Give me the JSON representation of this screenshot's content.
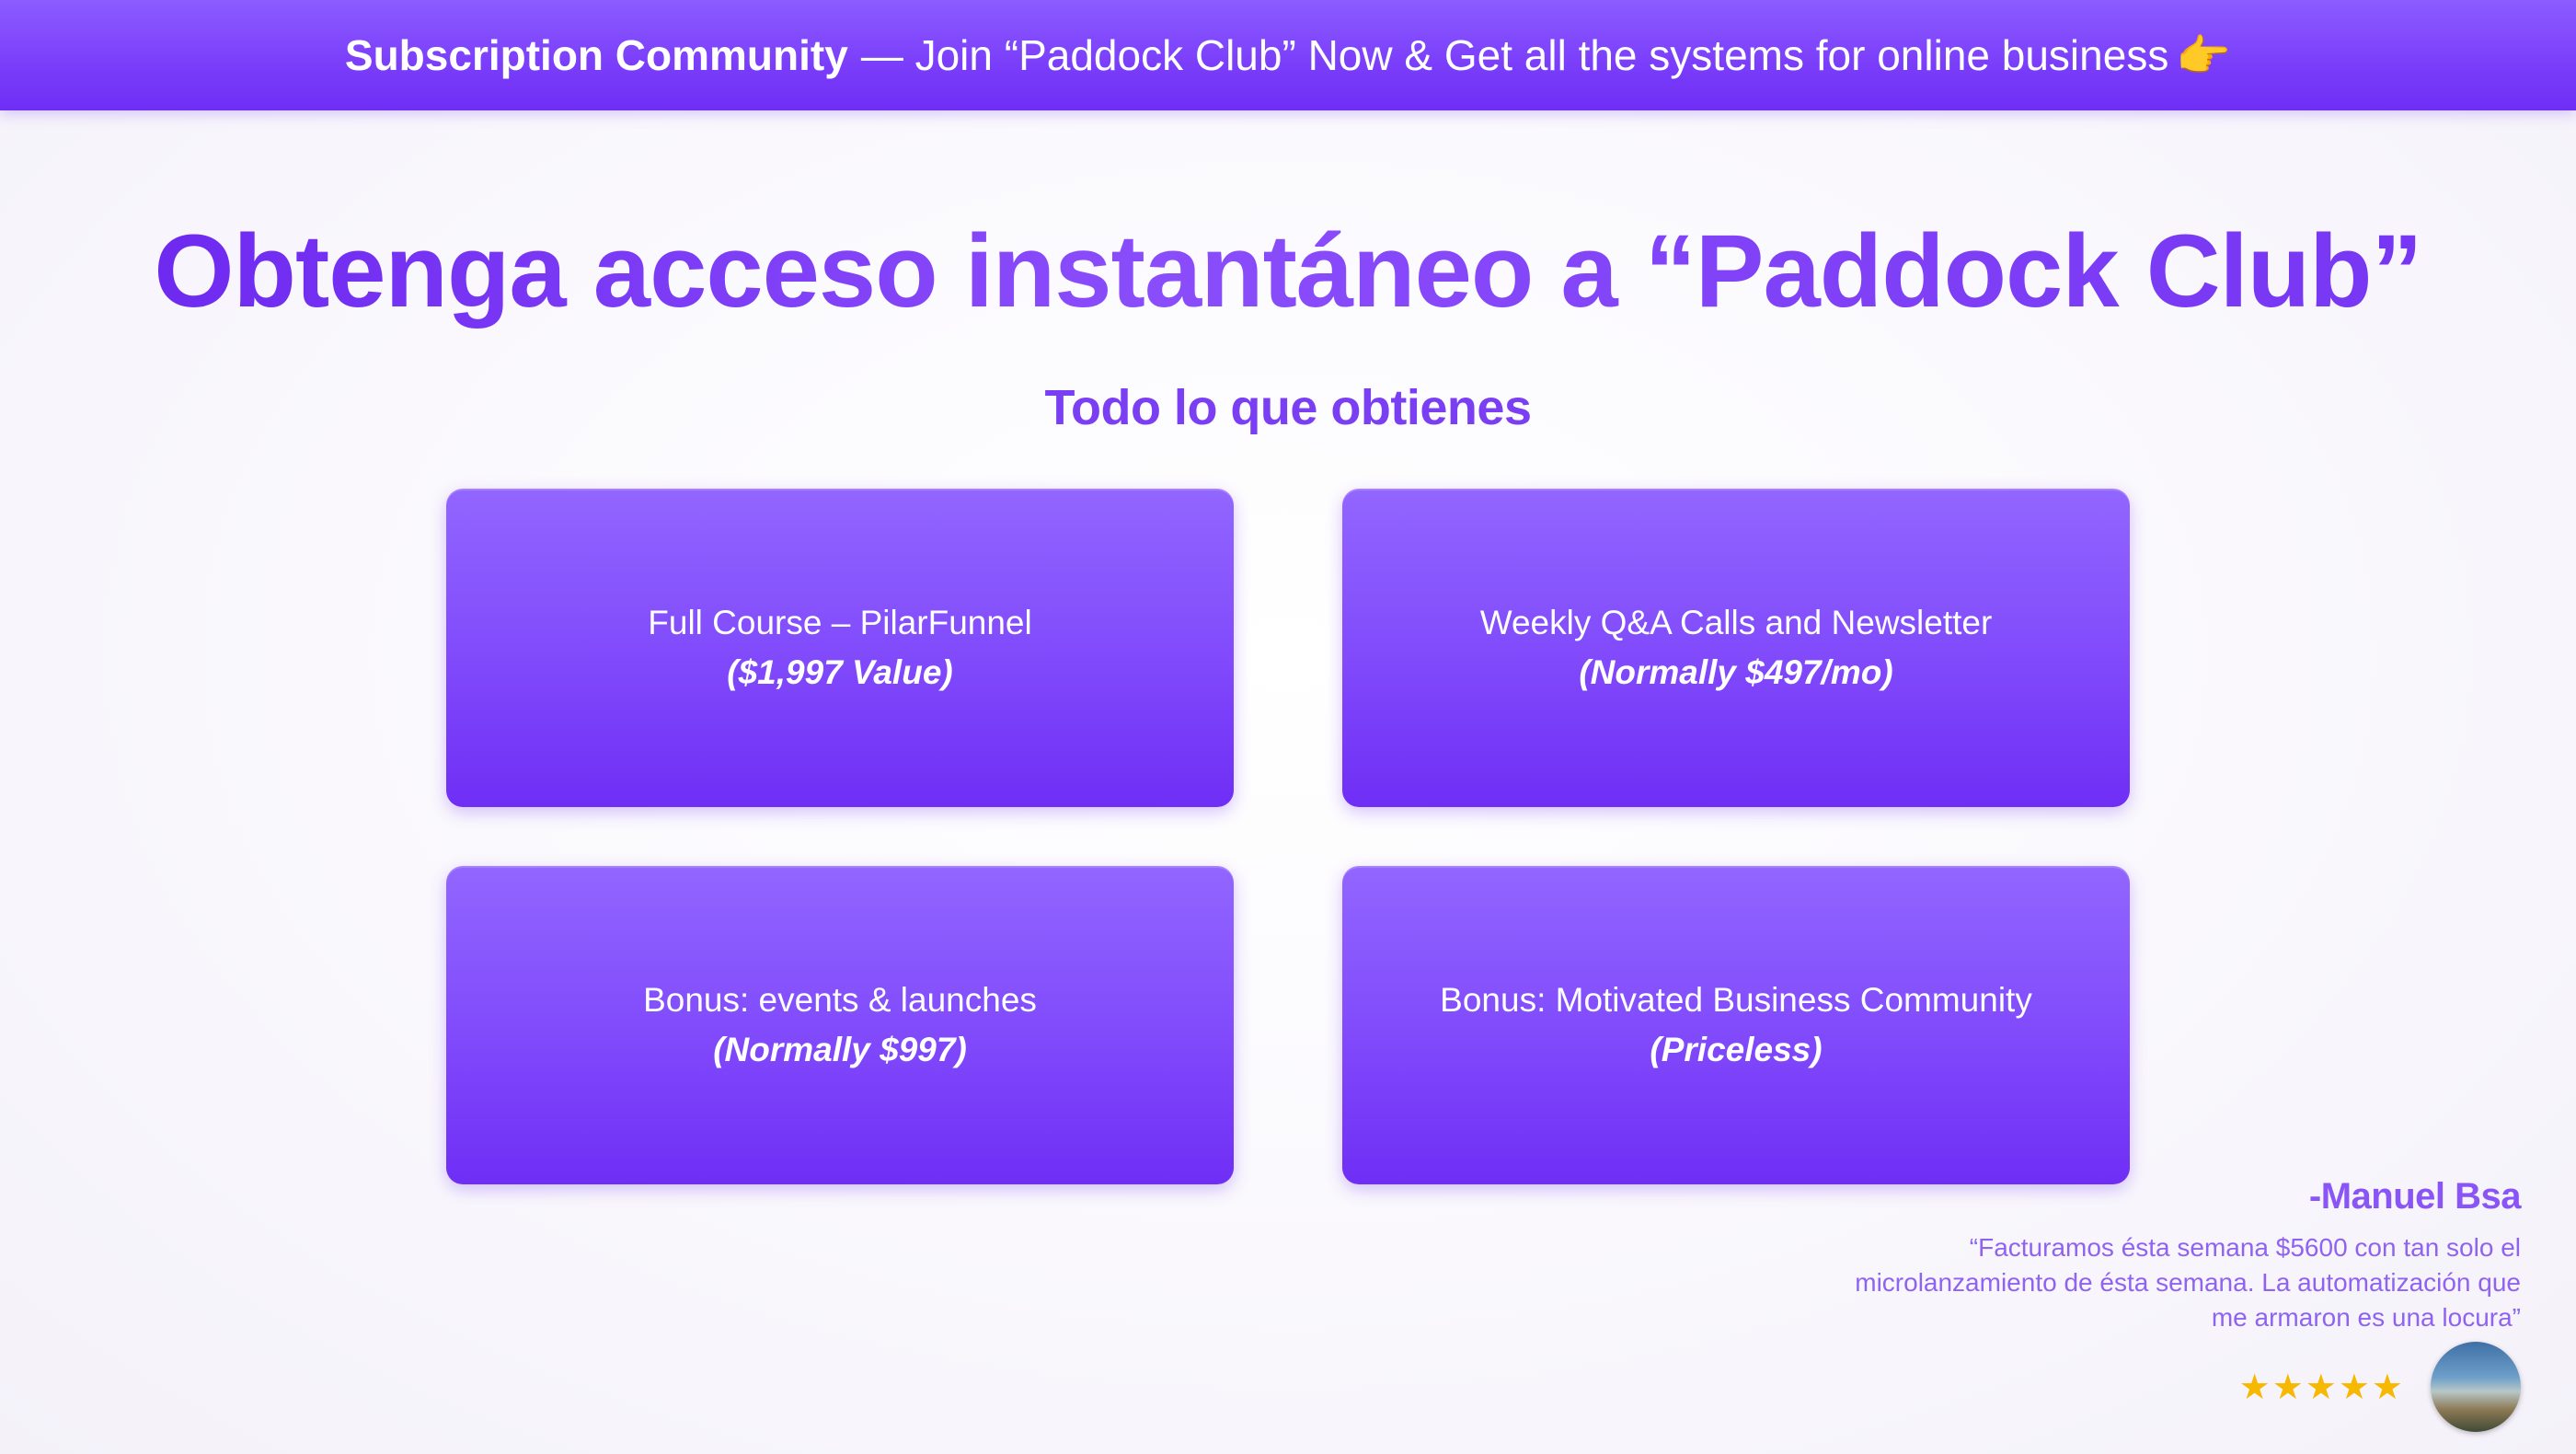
{
  "banner": {
    "strong": "Subscription Community",
    "rest": "— Join “Paddock Club” Now & Get all the systems for online business",
    "icon": "pointing-right-hand-icon"
  },
  "headline": "Obtenga acceso instantáneo a “Paddock Club”",
  "subheadline": "Todo lo que obtienes",
  "cards": [
    {
      "title": "Full Course – PilarFunnel",
      "value": "($1,997 Value)"
    },
    {
      "title": "Weekly Q&A Calls and Newsletter",
      "value": "(Normally $497/mo)"
    },
    {
      "title": "Bonus: events & launches",
      "value": "(Normally $997)"
    },
    {
      "title": "Bonus: Motivated Business Community",
      "value": "(Priceless)"
    }
  ],
  "testimonial": {
    "author": "-Manuel Bsa",
    "quote_line1": "“Facturamos ésta semana $5600 con tan solo el",
    "quote_line2": "microlanzamiento de ésta semana. La automatización que",
    "quote_line3": "me armaron es una locura”",
    "stars": "★★★★★",
    "rating": 5
  },
  "colors": {
    "accent": "#7b3ff3",
    "banner": "#7a3dfa",
    "stars": "#f6b800"
  }
}
